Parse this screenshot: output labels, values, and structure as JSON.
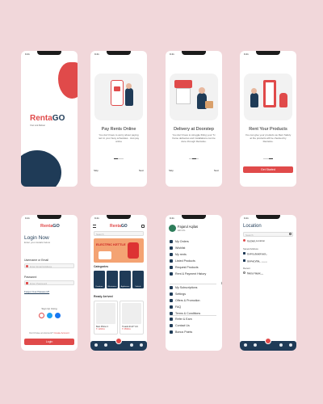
{
  "status_time": "9:41",
  "brand": {
    "rent": "Renta",
    "go": "GO",
    "tagline": "Your rent Partner"
  },
  "onboarding": [
    {
      "title": "Pay Rents Online",
      "desc": "You don't have to worry about paying rent in your busy schedules . Just pay online",
      "skip": "Skip",
      "next": "Next"
    },
    {
      "title": "Delivery at Doorstep",
      "desc": "You don't have to struggle fitting your Tv frame deliveries and installations can be done through RentaGo.",
      "skip": "Skip",
      "next": "Next"
    },
    {
      "title": "Rent Your Products",
      "desc": "You can give your products as Rent Safely at the products will be checked by RentaGo.",
      "button": "Get Started"
    }
  ],
  "login": {
    "title": "Login Now",
    "subtitle": "Enter your details below",
    "username_label": "Username or Email",
    "username_placeholder": "Enter Email Address",
    "password_label": "Password",
    "password_placeholder": "Enter Password",
    "forgot": "Forgot Your Password?",
    "signup_using": "Sign Up Using",
    "no_account": "Don't have an Account?",
    "create": "Create Account",
    "button": "Login"
  },
  "home": {
    "search_placeholder": "Search",
    "banner": "ELECTRIC KETTLE",
    "categories_label": "Categories",
    "categories": [
      "Furniture",
      "Electronics",
      "Appliances",
      "Vehicle"
    ],
    "ready_label": "Ready Arrived",
    "products": [
      {
        "name": "Best Pillow C",
        "price": "₹ 1290/m"
      },
      {
        "name": "Treadmill AP Y21",
        "price": "₹ 3599/m"
      }
    ]
  },
  "menu": {
    "user": "Fajarul Aqilas",
    "edit": "Edit info",
    "items_a": [
      "My Orders",
      "Wishlist",
      "My rents",
      "Listed Products",
      "Request Products",
      "Rent & Payment History"
    ],
    "items_b": [
      "My Subscriptions",
      "Settings",
      "Offers & Promotion",
      "FAQ",
      "Terms & Conditions"
    ],
    "items_c": [
      "Refer & Earn",
      "Contact Us",
      "Bonus Points"
    ]
  },
  "location": {
    "title": "Location",
    "search_placeholder": "Search",
    "current": "Current Location",
    "current_sub": "Using GPS",
    "saved_label": "Saved Address",
    "saved": [
      {
        "name": "Colors Apartment",
        "addr": "Rd 3, Tamil Nadu, 600001"
      },
      {
        "name": "Global Villa",
        "addr": "Rd 9, Tamil Nadu, 600001"
      }
    ],
    "recent_label": "Recent",
    "recent": [
      {
        "name": "Metro Nagar",
        "addr": "Chennai, Tamil Nadu"
      }
    ]
  },
  "colors": {
    "accent": "#e04a4a",
    "navy": "#1f3b57",
    "bg": "#f1d7da"
  }
}
